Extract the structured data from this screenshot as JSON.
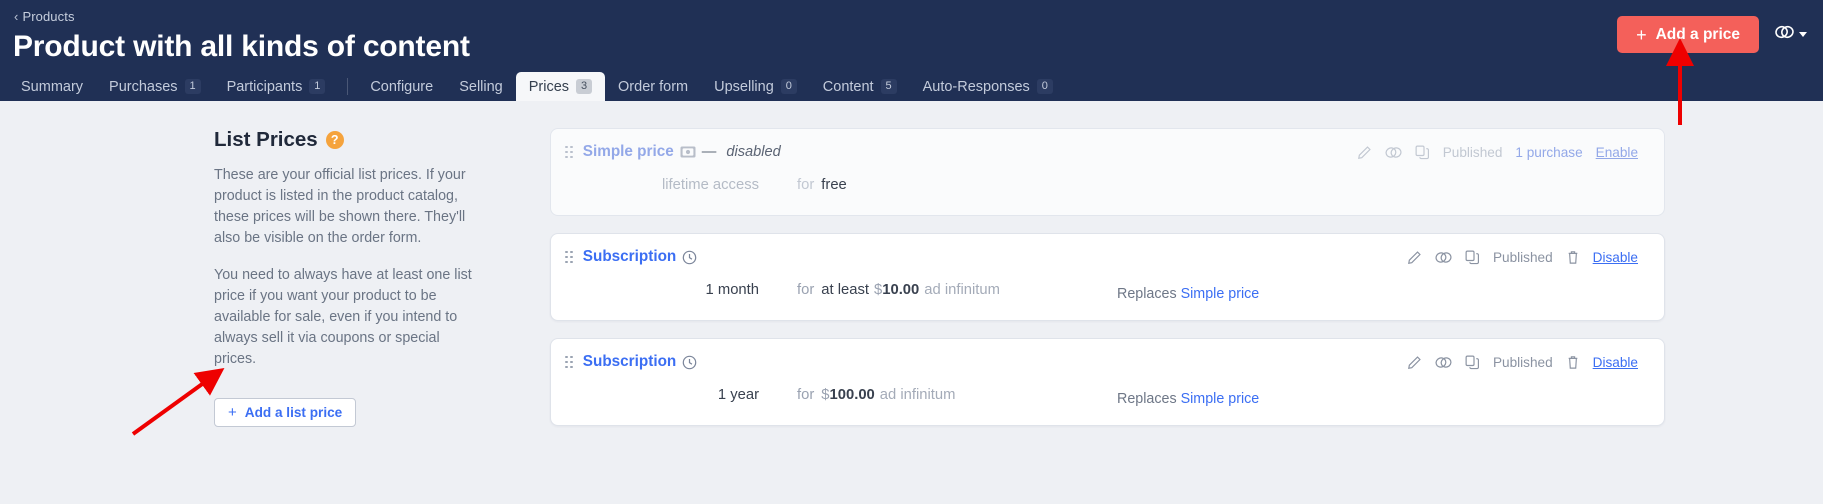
{
  "header": {
    "breadcrumb": {
      "chevron": "‹",
      "label": "Products"
    },
    "title": "Product with all kinds of content",
    "add_price_button": {
      "plus": "+",
      "label": "Add a price"
    },
    "link_menu_icon": "link-icon"
  },
  "tabs": [
    {
      "label": "Summary",
      "badge": null,
      "active": false
    },
    {
      "label": "Purchases",
      "badge": "1",
      "active": false
    },
    {
      "label": "Participants",
      "badge": "1",
      "active": false
    },
    {
      "label": "Configure",
      "badge": null,
      "active": false
    },
    {
      "label": "Selling",
      "badge": null,
      "active": false
    },
    {
      "label": "Prices",
      "badge": "3",
      "active": true
    },
    {
      "label": "Order form",
      "badge": null,
      "active": false
    },
    {
      "label": "Upselling",
      "badge": "0",
      "active": false
    },
    {
      "label": "Content",
      "badge": "5",
      "active": false
    },
    {
      "label": "Auto-Responses",
      "badge": "0",
      "active": false
    }
  ],
  "sidebar": {
    "title": "List Prices",
    "help_icon": "?",
    "paragraph1": "These are your official list prices. If your product is listed in the product catalog, these prices will be shown there. They'll also be visible on the order form.",
    "paragraph2": "You need to always have at least one list price if you want your product to be available for sale, even if you intend to always sell it via coupons or special prices.",
    "add_list_price_button": {
      "plus": "+",
      "label": "Add a list price"
    }
  },
  "cards": [
    {
      "type": "Simple price",
      "type_icon": "banknote-icon",
      "disabled": true,
      "dash": "—",
      "state_note": "disabled",
      "duration": "lifetime access",
      "for_label": "for",
      "qualifier": "",
      "currency": "",
      "amount": "free",
      "suffix": "",
      "replaces_label": "",
      "replaces_target": "",
      "status": "Published",
      "purchases": "1 purchase",
      "toggle_label": "Enable",
      "has_trash": false
    },
    {
      "type": "Subscription",
      "type_icon": "clock-icon",
      "disabled": false,
      "dash": "",
      "state_note": "",
      "duration": "1 month",
      "for_label": "for",
      "qualifier": "at least",
      "currency": "$",
      "amount": "10.00",
      "suffix": "ad infinitum",
      "replaces_label": "Replaces",
      "replaces_target": "Simple price",
      "status": "Published",
      "purchases": "",
      "toggle_label": "Disable",
      "has_trash": true
    },
    {
      "type": "Subscription",
      "type_icon": "clock-icon",
      "disabled": false,
      "dash": "",
      "state_note": "",
      "duration": "1 year",
      "for_label": "for",
      "qualifier": "",
      "currency": "$",
      "amount": "100.00",
      "suffix": "ad infinitum",
      "replaces_label": "Replaces",
      "replaces_target": "Simple price",
      "status": "Published",
      "purchases": "",
      "toggle_label": "Disable",
      "has_trash": true
    }
  ],
  "colors": {
    "header_bg": "#203055",
    "accent_red": "#f4605a",
    "link_blue": "#3b6ef3",
    "help_orange": "#f5a33c",
    "page_bg": "#eef0f4",
    "annotation_red": "#ee0000"
  }
}
